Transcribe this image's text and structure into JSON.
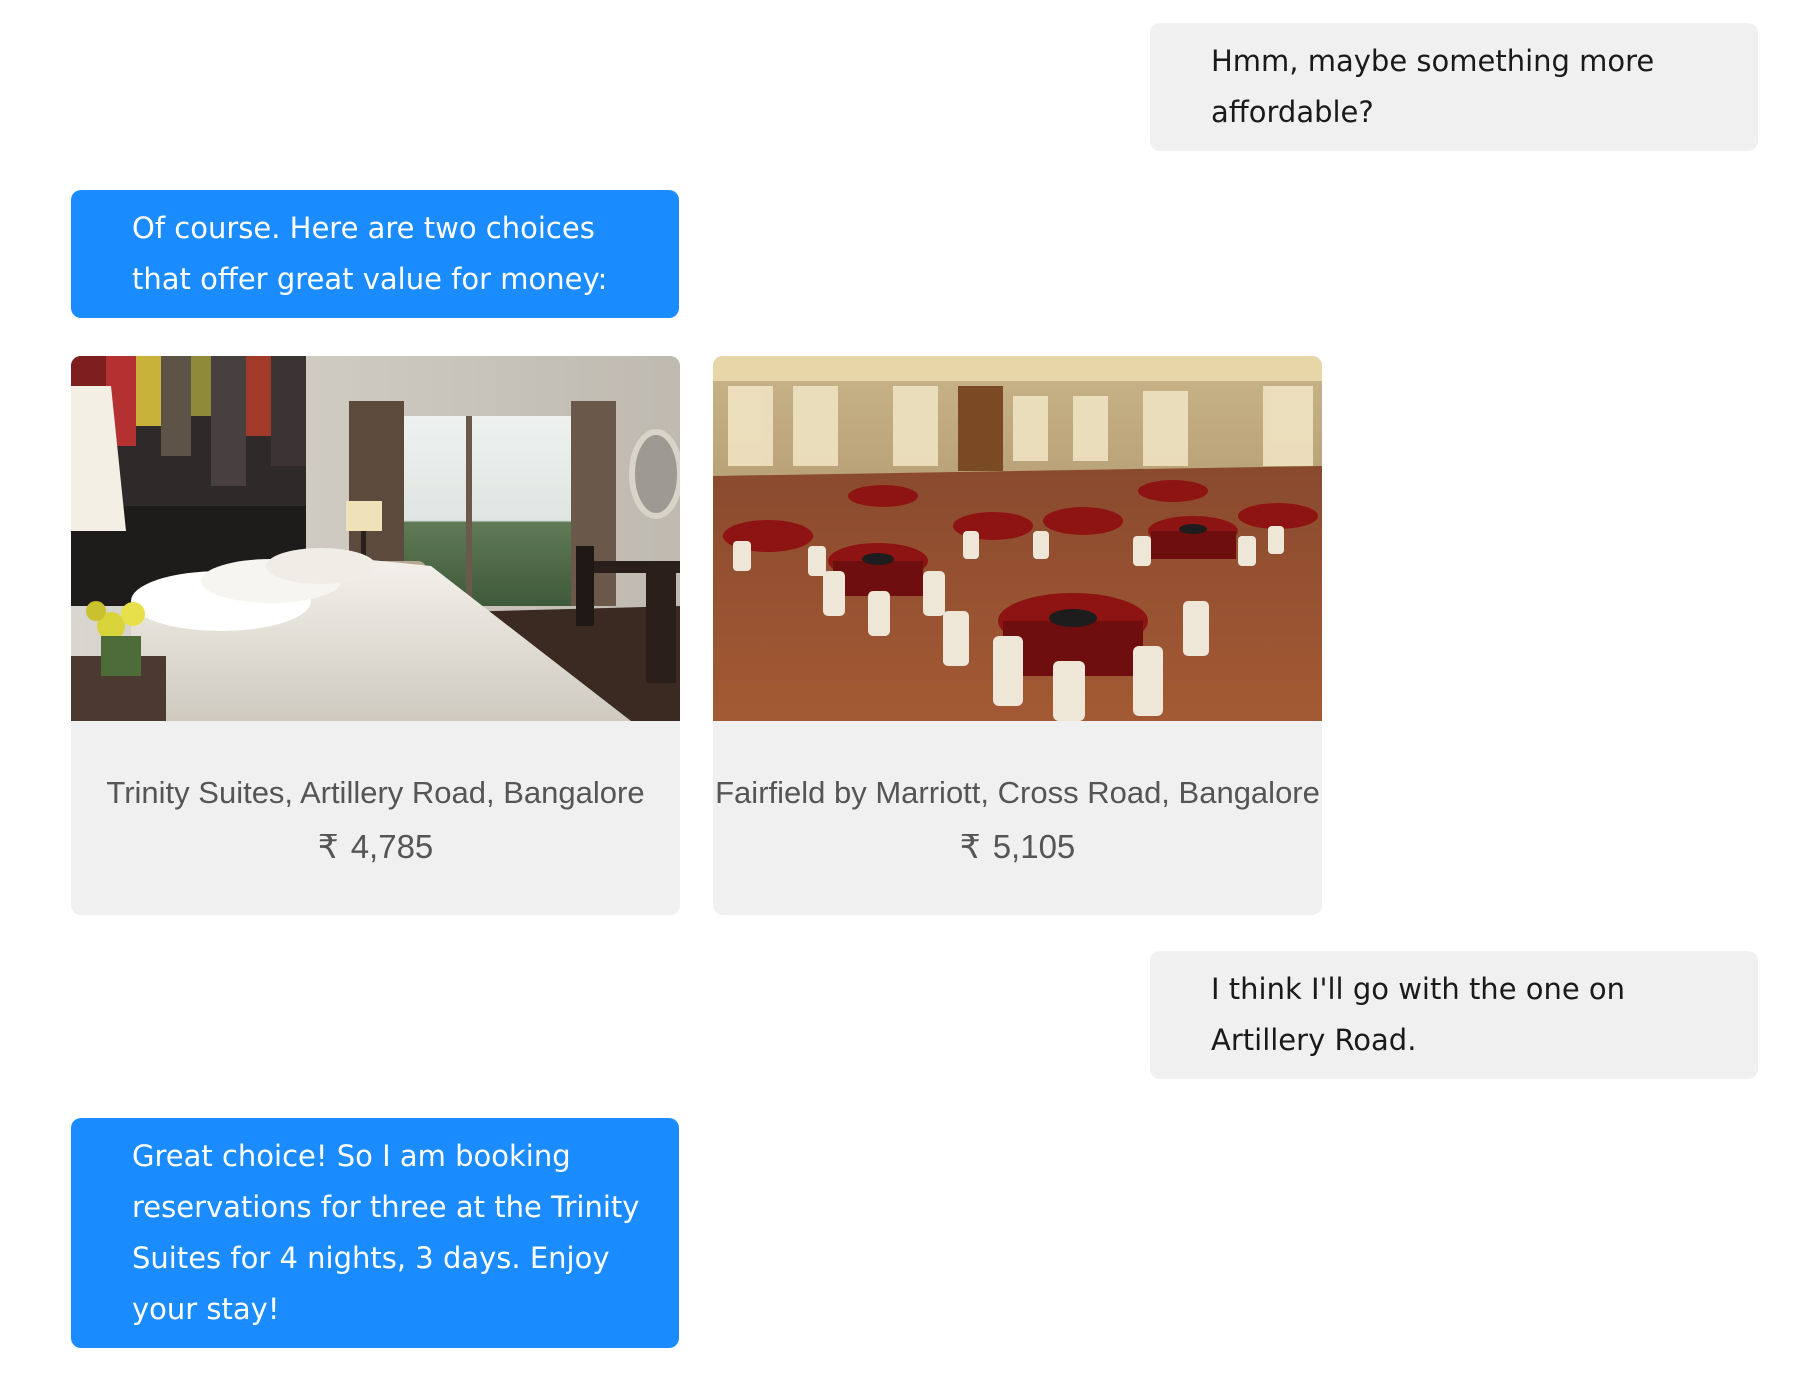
{
  "messages": [
    {
      "from": "user",
      "text": "Hmm, maybe something more affordable?"
    },
    {
      "from": "bot",
      "text": "Of course. Here are two choices that offer great value for money:"
    },
    {
      "from": "user",
      "text": "I think I'll go with the one on Artillery Road."
    },
    {
      "from": "bot",
      "text": "Great choice! So I am booking reservations for three at the Trinity Suites for 4 nights, 3 days. Enjoy your stay!"
    }
  ],
  "hotels": [
    {
      "name": "Trinity Suites, Artillery Road, Bangalore",
      "currency": "₹",
      "price": "4,785"
    },
    {
      "name": "Fairfield by Marriott, Cross Road, Bangalore",
      "currency": "₹",
      "price": "5,105"
    }
  ],
  "colors": {
    "bot_bubble": "#1a8cff",
    "user_bubble": "#f0f0f0",
    "card_bg": "#f0f0f0"
  }
}
